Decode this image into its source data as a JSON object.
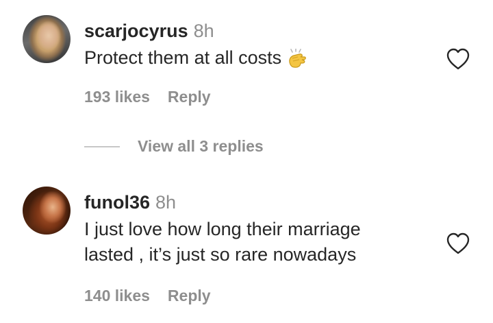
{
  "comments": [
    {
      "username": "scarjocyrus",
      "time": "8h",
      "text_lines": [
        "Protect them at all costs"
      ],
      "emoji": "clapping-hands-icon",
      "likes": "193 likes",
      "reply_label": "Reply"
    },
    {
      "username": "funol36",
      "time": "8h",
      "text_lines": [
        "I just love how long their marriage",
        "lasted , it’s just so rare nowadays"
      ],
      "likes": "140 likes",
      "reply_label": "Reply"
    }
  ],
  "view_replies": {
    "label": "View all 3 replies"
  },
  "colors": {
    "primary_text": "#262626",
    "secondary_text": "#8e8e8e",
    "divider": "#c7c7c7"
  }
}
